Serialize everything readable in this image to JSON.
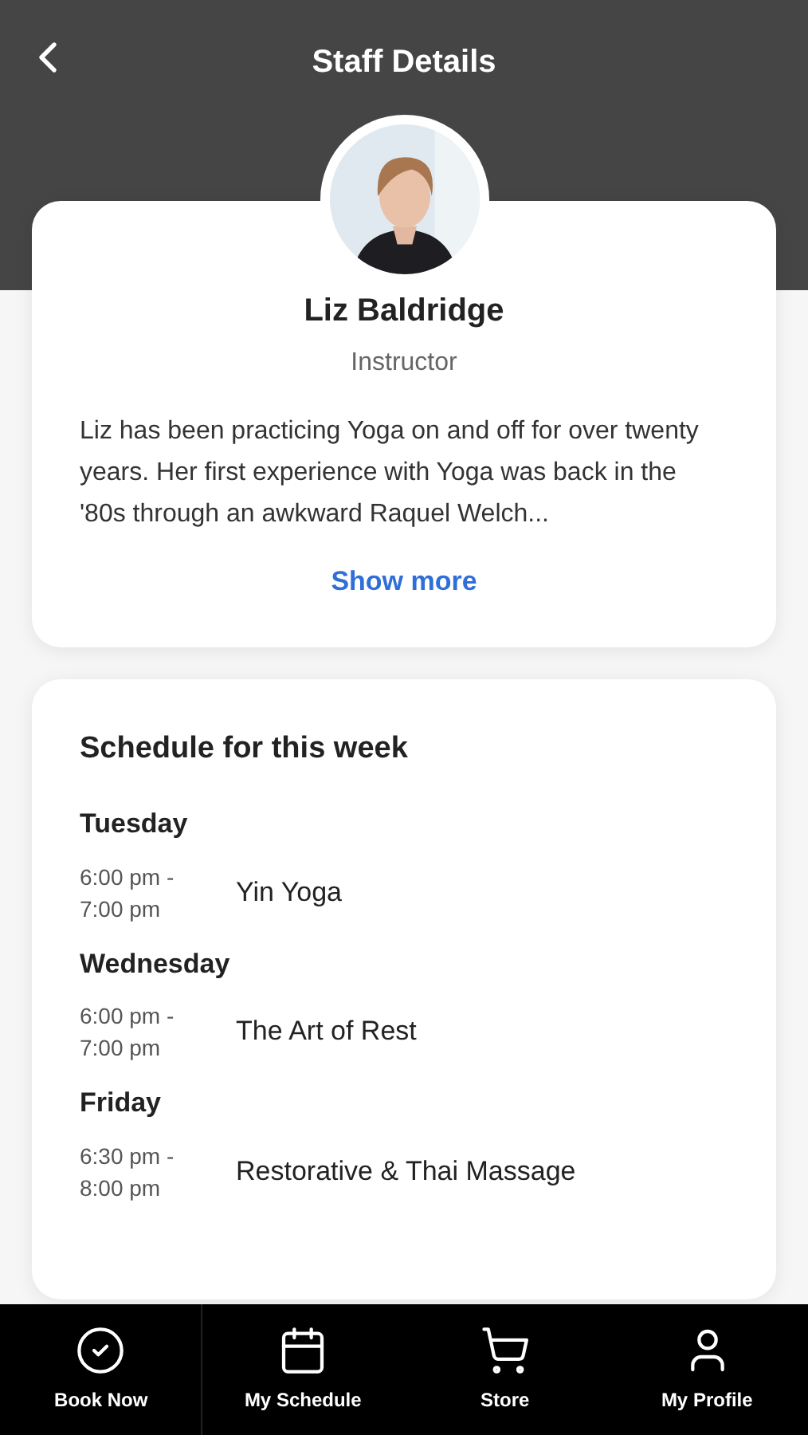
{
  "header": {
    "title": "Staff Details"
  },
  "profile": {
    "name": "Liz Baldridge",
    "role": "Instructor",
    "bio": "Liz has been practicing Yoga on and off for over twenty years. Her first experience with Yoga was back in the '80s through an awkward Raquel Welch...",
    "show_more": "Show more"
  },
  "schedule": {
    "title": "Schedule for this week",
    "days": [
      {
        "day": "Tuesday",
        "classes": [
          {
            "time": "6:00 pm - 7:00 pm",
            "name": "Yin Yoga"
          }
        ]
      },
      {
        "day": "Wednesday",
        "classes": [
          {
            "time": "6:00 pm - 7:00 pm",
            "name": "The Art of Rest"
          }
        ]
      },
      {
        "day": "Friday",
        "classes": [
          {
            "time": "6:30 pm - 8:00 pm",
            "name": "Restorative & Thai Massage"
          }
        ]
      }
    ]
  },
  "nav": [
    {
      "label": "Book Now"
    },
    {
      "label": "My Schedule"
    },
    {
      "label": "Store"
    },
    {
      "label": "My Profile"
    }
  ]
}
